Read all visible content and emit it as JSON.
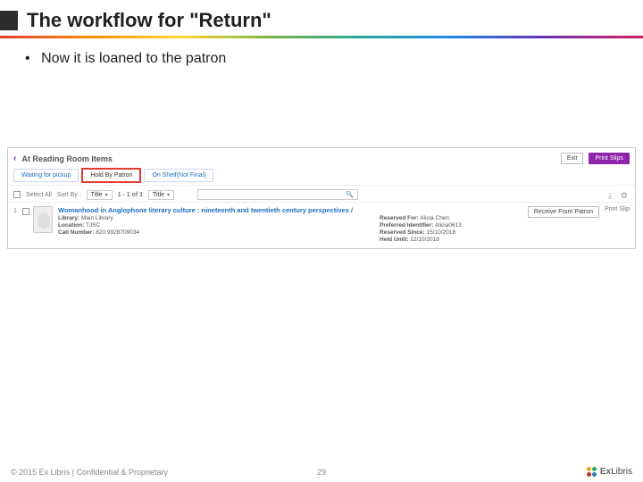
{
  "slide": {
    "title": "The workflow for \"Return\"",
    "bullet": "Now it is loaned to the patron",
    "page_number": "29",
    "copyright": "© 2015 Ex Libris | Confidential & Proprietary",
    "logo_text_a": "Ex",
    "logo_text_b": "Libris"
  },
  "panel": {
    "title": "At Reading Room Items",
    "exit_btn": "Exit",
    "print_btn": "Print Slips",
    "tabs": [
      {
        "label": "Waiting for pickup"
      },
      {
        "label": "Hold By Patron"
      },
      {
        "label": "On Shelf(Not Final)"
      }
    ],
    "controls": {
      "select_all": "Select All",
      "sort_by_label": "Sort By :",
      "sort_by_value": "Title",
      "range": "1 - 1 of 1",
      "secondary": "Title"
    },
    "item": {
      "index": "1",
      "title": "Womanhood in Anglophone literary culture : nineteenth and twentieth century perspectives /",
      "library_label": "Library:",
      "library_value": "Main Library",
      "location_label": "Location:",
      "location_value": "TJSC",
      "callno_label": "Call Number:",
      "callno_value": "820.9928709034",
      "reserved_for_label": "Reserved For:",
      "reserved_for_value": "Alicia Chen",
      "pref_id_label": "Preferred Identifier:",
      "pref_id_value": "Alicia0613",
      "reserved_since_label": "Reserved Since:",
      "reserved_since_value": "15/10/2018",
      "held_until_label": "Held Until:",
      "held_until_value": "22/10/2018",
      "action_receive": "Receive From Patron",
      "action_print": "Print Slip"
    }
  }
}
